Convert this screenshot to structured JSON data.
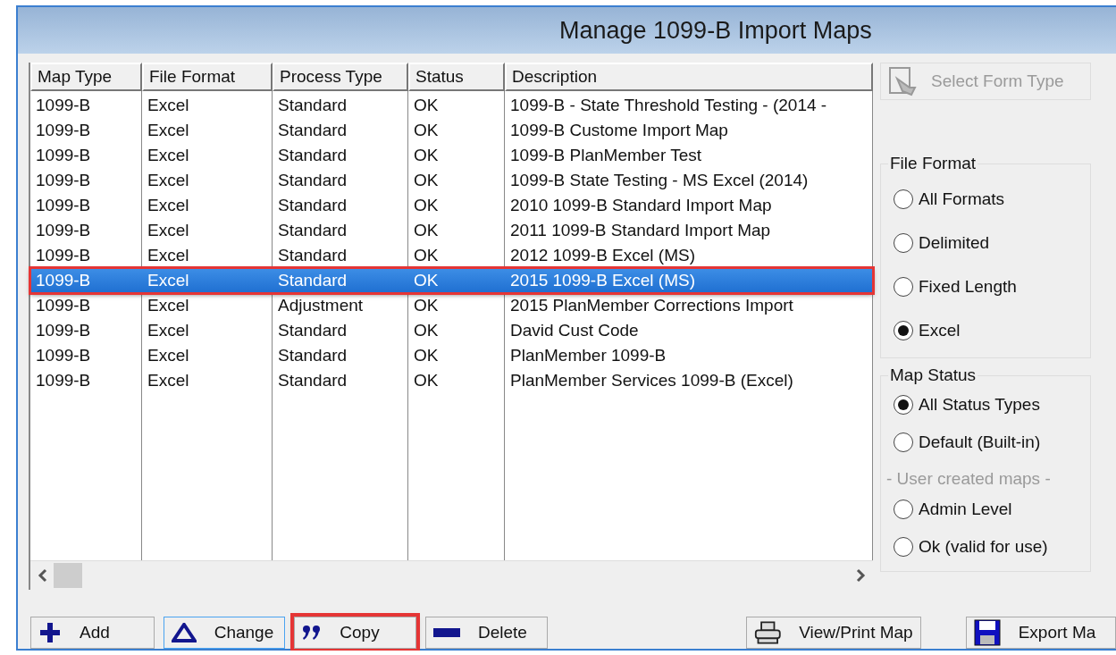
{
  "window": {
    "title": "Manage 1099-B Import Maps"
  },
  "table": {
    "columns": [
      "Map Type",
      "File Format",
      "Process Type",
      "Status",
      "Description"
    ],
    "rows": [
      {
        "cells": [
          "1099-B",
          "Excel",
          "Standard",
          "OK",
          "1099-B - State Threshold Testing - (2014 -"
        ],
        "selected": false,
        "highlighted": false
      },
      {
        "cells": [
          "1099-B",
          "Excel",
          "Standard",
          "OK",
          "1099-B Custome Import Map"
        ],
        "selected": false,
        "highlighted": false
      },
      {
        "cells": [
          "1099-B",
          "Excel",
          "Standard",
          "OK",
          "1099-B PlanMember Test"
        ],
        "selected": false,
        "highlighted": false
      },
      {
        "cells": [
          "1099-B",
          "Excel",
          "Standard",
          "OK",
          "1099-B State Testing - MS Excel (2014)"
        ],
        "selected": false,
        "highlighted": false
      },
      {
        "cells": [
          "1099-B",
          "Excel",
          "Standard",
          "OK",
          "2010 1099-B Standard Import Map"
        ],
        "selected": false,
        "highlighted": false
      },
      {
        "cells": [
          "1099-B",
          "Excel",
          "Standard",
          "OK",
          "2011 1099-B Standard Import Map"
        ],
        "selected": false,
        "highlighted": false
      },
      {
        "cells": [
          "1099-B",
          "Excel",
          "Standard",
          "OK",
          "2012 1099-B Excel (MS)"
        ],
        "selected": false,
        "highlighted": false
      },
      {
        "cells": [
          "1099-B",
          "Excel",
          "Standard",
          "OK",
          "2015 1099-B Excel (MS)"
        ],
        "selected": true,
        "highlighted": true
      },
      {
        "cells": [
          "1099-B",
          "Excel",
          "Adjustment",
          "OK",
          "2015 PlanMember Corrections Import"
        ],
        "selected": false,
        "highlighted": false
      },
      {
        "cells": [
          "1099-B",
          "Excel",
          "Standard",
          "OK",
          "David Cust Code"
        ],
        "selected": false,
        "highlighted": false
      },
      {
        "cells": [
          "1099-B",
          "Excel",
          "Standard",
          "OK",
          "PlanMember 1099-B"
        ],
        "selected": false,
        "highlighted": false
      },
      {
        "cells": [
          "1099-B",
          "Excel",
          "Standard",
          "OK",
          "PlanMember Services 1099-B (Excel)"
        ],
        "selected": false,
        "highlighted": false
      }
    ]
  },
  "select_form_type": {
    "label": "Select Form Type",
    "disabled": true
  },
  "file_format": {
    "title": "File Format",
    "options": [
      {
        "label": "All Formats",
        "selected": false
      },
      {
        "label": "Delimited",
        "selected": false
      },
      {
        "label": "Fixed Length",
        "selected": false
      },
      {
        "label": "Excel",
        "selected": true
      }
    ]
  },
  "map_status": {
    "title": "Map Status",
    "items": [
      {
        "kind": "radio",
        "label": "All Status Types",
        "selected": true
      },
      {
        "kind": "radio",
        "label": "Default (Built-in)",
        "selected": false
      },
      {
        "kind": "caption",
        "label": "- User created maps -"
      },
      {
        "kind": "radio",
        "label": "Admin Level",
        "selected": false
      },
      {
        "kind": "radio",
        "label": "Ok (valid for use)",
        "selected": false
      }
    ]
  },
  "buttons": [
    {
      "kind": "add",
      "label": "Add",
      "focused": false,
      "highlighted": false
    },
    {
      "kind": "change",
      "label": "Change",
      "focused": true,
      "highlighted": false
    },
    {
      "kind": "copy",
      "label": "Copy",
      "focused": false,
      "highlighted": true
    },
    {
      "kind": "delete",
      "label": "Delete",
      "focused": false,
      "highlighted": false
    },
    {
      "kind": "print",
      "label": "View/Print Map",
      "focused": false,
      "highlighted": false
    },
    {
      "kind": "export",
      "label": "Export Ma",
      "focused": false,
      "highlighted": false
    }
  ]
}
